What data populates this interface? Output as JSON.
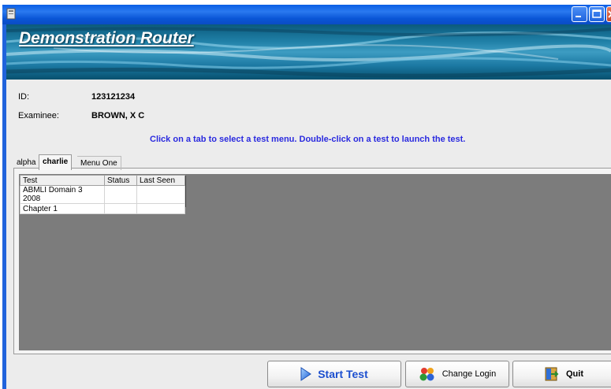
{
  "app": {
    "banner_title": "Demonstration Router"
  },
  "examinee_info": {
    "id_label": "ID:",
    "id_value": "123121234",
    "examinee_label": "Examinee:",
    "examinee_value": "BROWN, X C"
  },
  "instructions": "Click on a tab to select a test menu.  Double-click on a test to launch the test.",
  "tabs": [
    {
      "label": "alpha",
      "selected": false
    },
    {
      "label": "charlie",
      "selected": true
    },
    {
      "label": "Menu One",
      "selected": false
    }
  ],
  "test_table": {
    "columns": [
      "Test",
      "Status",
      "Last Seen"
    ],
    "rows": [
      [
        "ABMLI Domain 3 2008",
        "",
        ""
      ],
      [
        "Chapter 1",
        "",
        ""
      ]
    ]
  },
  "buttons": {
    "start_test": "Start Test",
    "change_login": "Change Login",
    "quit": "Quit"
  },
  "colors": {
    "accent_text": "#2a2adf",
    "titlebar": "#0a56d6",
    "list_background": "#7c7c7c"
  },
  "icons": {
    "start_test": "play-arrow-icon",
    "change_login": "people-icon",
    "quit": "exit-door-icon"
  }
}
